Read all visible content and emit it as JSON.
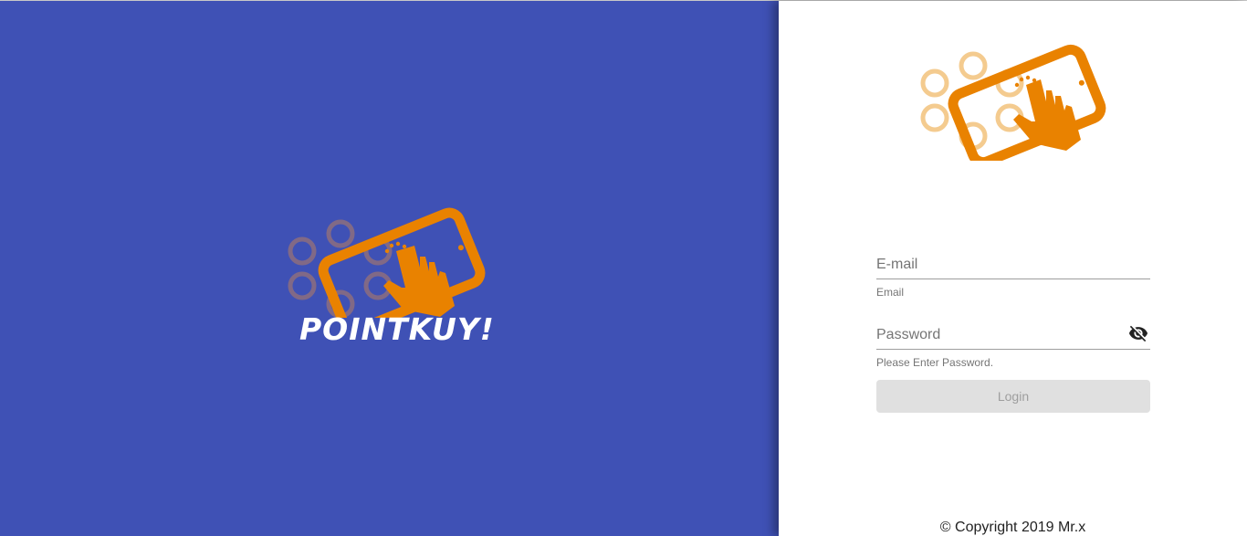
{
  "brand": {
    "name": "POINTKUY!",
    "logo_icon": "tablet-tap-icon",
    "accent_color": "#e98200",
    "panel_color": "#3f51b5"
  },
  "login_form": {
    "email": {
      "placeholder": "E-mail",
      "value": "",
      "hint": "Email"
    },
    "password": {
      "placeholder": "Password",
      "value": "",
      "hint": "Please Enter Password.",
      "toggle_icon": "eye-off-icon"
    },
    "login_label": "Login"
  },
  "footer": {
    "copyright": "© Copyright 2019 Mr.x"
  }
}
